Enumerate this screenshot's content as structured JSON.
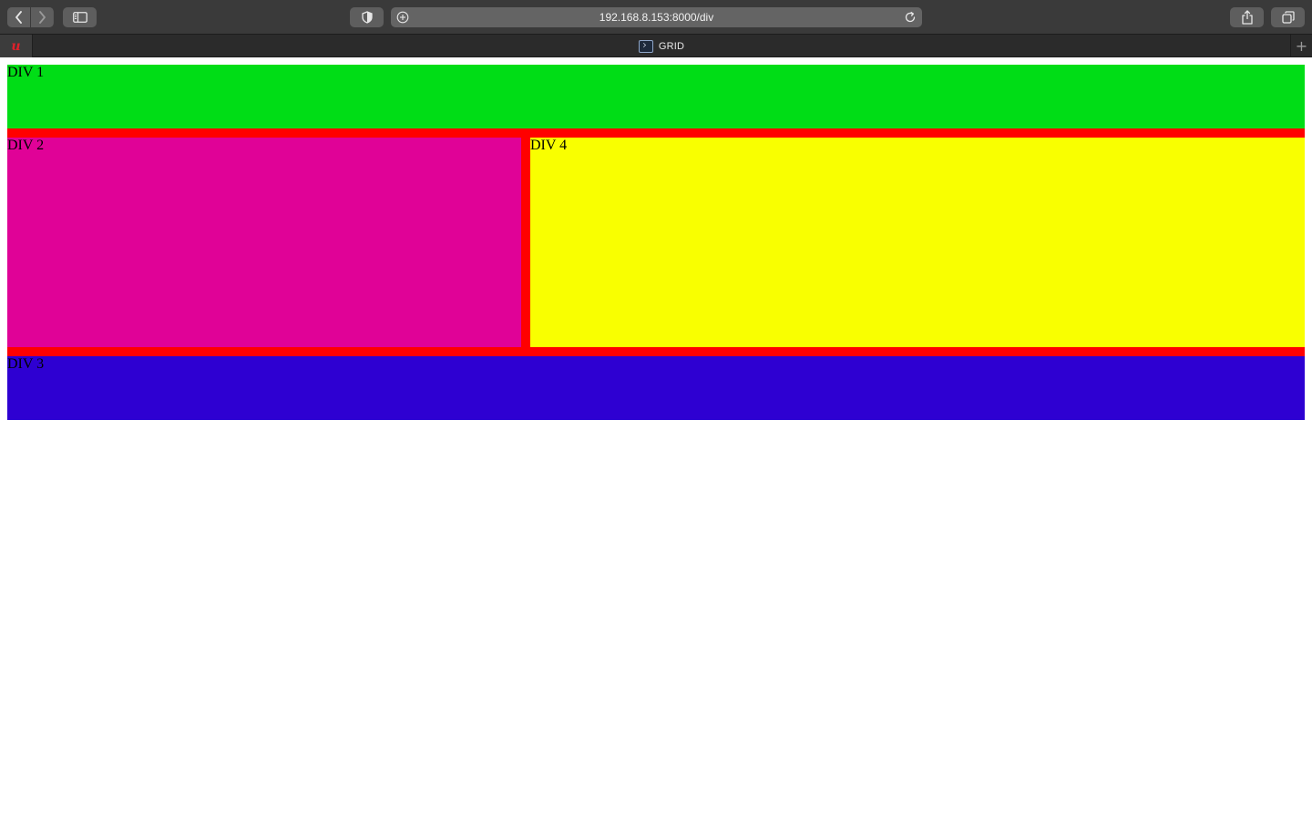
{
  "browser": {
    "url": "192.168.8.153:8000/div",
    "icons": {
      "back": "chevron-left-icon",
      "forward": "chevron-right-icon",
      "sidebar": "sidebar-icon",
      "privacy": "shield-icon",
      "site": "compass-icon",
      "reload": "reload-icon",
      "share": "share-icon",
      "tabs": "tabs-overview-icon",
      "new_tab": "plus-icon"
    },
    "pinned_tab": {
      "glyph": "u"
    },
    "active_tab": {
      "title": "GRID"
    },
    "new_tab_label": "+"
  },
  "page": {
    "divs": [
      {
        "label": "DIV 1",
        "color": "#00dd16"
      },
      {
        "label": "DIV 2",
        "color": "#e00297"
      },
      {
        "label": "DIV 3",
        "color": "#2e00d2"
      },
      {
        "label": "DIV 4",
        "color": "#f9ff00"
      }
    ],
    "container_color": "#ff0000"
  }
}
